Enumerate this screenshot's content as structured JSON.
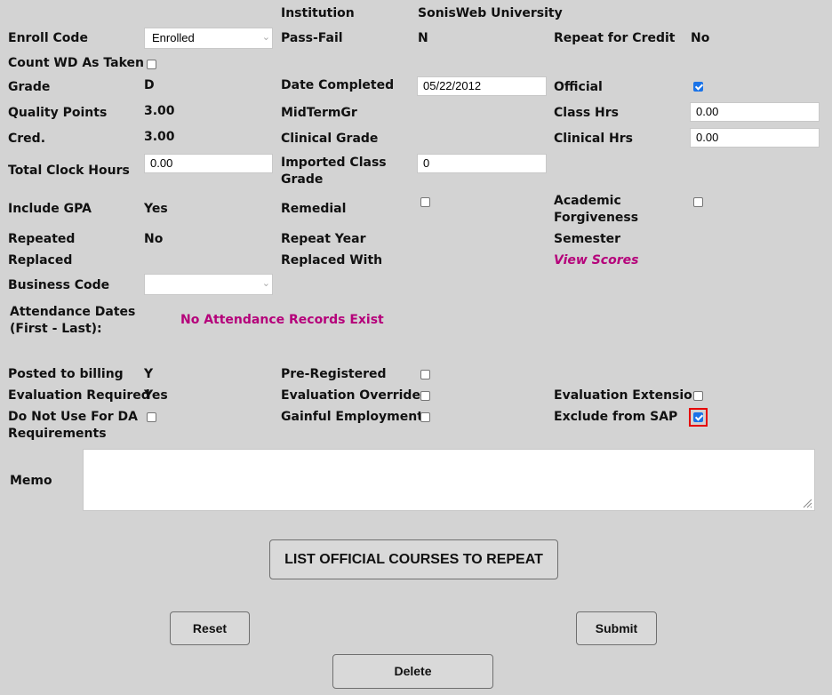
{
  "fields": {
    "institution": {
      "label": "Institution",
      "value": "SonisWeb University"
    },
    "enroll_code": {
      "label": "Enroll Code",
      "value": "Enrolled"
    },
    "pass_fail": {
      "label": "Pass-Fail",
      "value": "N"
    },
    "repeat_for_credit": {
      "label": "Repeat for Credit",
      "value": "No"
    },
    "count_wd": {
      "label": "Count WD As Taken",
      "checked": false
    },
    "grade": {
      "label": "Grade",
      "value": "D"
    },
    "date_completed": {
      "label": "Date Completed",
      "value": "05/22/2012"
    },
    "official": {
      "label": "Official",
      "checked": true
    },
    "quality_points": {
      "label": "Quality Points",
      "value": "3.00"
    },
    "midterm": {
      "label": "MidTermGr",
      "value": ""
    },
    "class_hrs": {
      "label": "Class Hrs",
      "value": "0.00"
    },
    "cred": {
      "label": "Cred.",
      "value": "3.00"
    },
    "clinical_grade": {
      "label": "Clinical Grade",
      "value": ""
    },
    "clinical_hrs": {
      "label": "Clinical Hrs",
      "value": "0.00"
    },
    "total_clock_hours": {
      "label": "Total Clock Hours",
      "value": "0.00"
    },
    "imported_class_grade": {
      "label": "Imported Class Grade",
      "value": "0"
    },
    "include_gpa": {
      "label": "Include GPA",
      "value": "Yes"
    },
    "remedial": {
      "label": "Remedial",
      "checked": false
    },
    "academic_forgiveness": {
      "label": "Academic Forgiveness",
      "checked": false
    },
    "repeated": {
      "label": "Repeated",
      "value": "No"
    },
    "repeat_year": {
      "label": "Repeat Year",
      "value": ""
    },
    "semester": {
      "label": "Semester",
      "value": ""
    },
    "replaced": {
      "label": "Replaced",
      "value": ""
    },
    "replaced_with": {
      "label": "Replaced With",
      "value": ""
    },
    "view_scores": {
      "label": "View Scores"
    },
    "business_code": {
      "label": "Business Code",
      "value": ""
    },
    "attendance": {
      "label": "Attendance Dates (First - Last):",
      "value": "No Attendance Records Exist"
    },
    "posted_to_billing": {
      "label": "Posted to billing",
      "value": "Y"
    },
    "pre_registered": {
      "label": "Pre-Registered",
      "checked": false
    },
    "evaluation_required": {
      "label": "Evaluation Required",
      "value": "Yes"
    },
    "evaluation_override": {
      "label": "Evaluation Override",
      "checked": false
    },
    "evaluation_extension": {
      "label": "Evaluation Extension",
      "checked": false
    },
    "do_not_use_da": {
      "label": "Do Not Use For DA Requirements",
      "checked": false
    },
    "gainful_employment": {
      "label": "Gainful Employment",
      "checked": false
    },
    "exclude_from_sap": {
      "label": "Exclude from SAP",
      "checked": true
    },
    "memo": {
      "label": "Memo",
      "value": ""
    }
  },
  "buttons": {
    "list_courses": "LIST OFFICIAL COURSES TO REPEAT",
    "reset": "Reset",
    "submit": "Submit",
    "delete": "Delete"
  },
  "colors": {
    "background": "#d3d3d3",
    "link": "#b5007a",
    "checkbox_checked": "#1a73e8",
    "highlight": "#e60000"
  }
}
